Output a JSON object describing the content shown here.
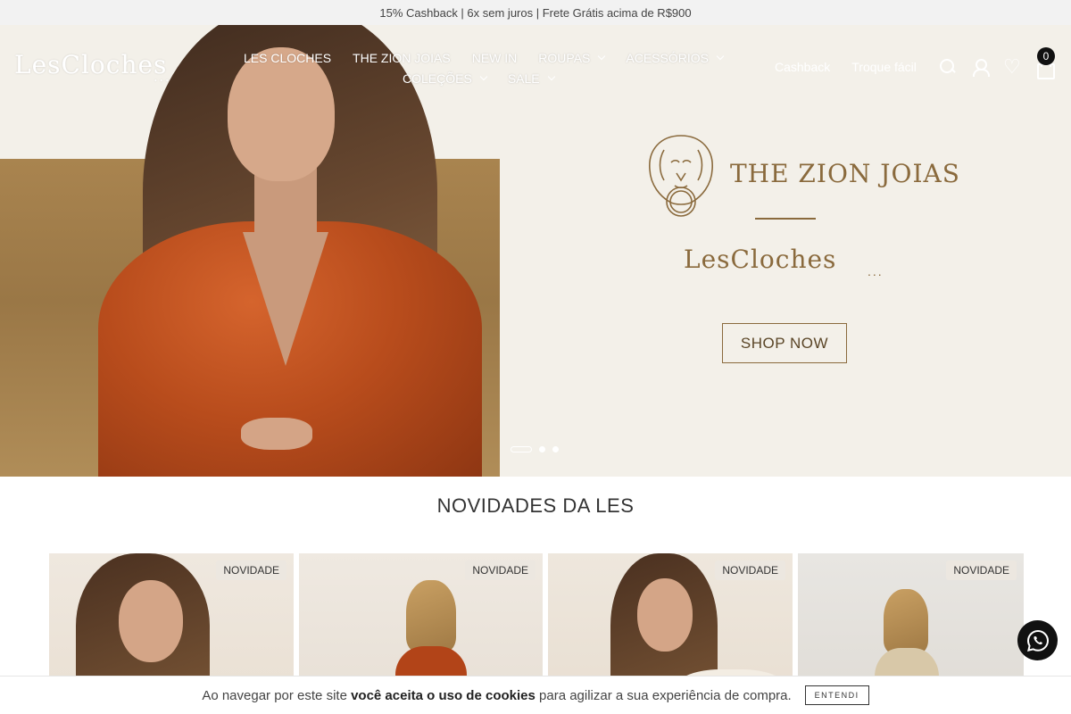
{
  "announcement": "15% Cashback | 6x sem juros | Frete Grátis acima de R$900",
  "header": {
    "logo": "LesCloches",
    "logo_dots": "...",
    "menu_row1": [
      {
        "label": "LES CLOCHES",
        "dropdown": false
      },
      {
        "label": "THE ZION JOIAS",
        "dropdown": false
      },
      {
        "label": "NEW IN",
        "dropdown": false
      },
      {
        "label": "ROUPAS",
        "dropdown": true
      },
      {
        "label": "ACESSÓRIOS",
        "dropdown": true
      }
    ],
    "menu_row2": [
      {
        "label": "COLEÇÕES",
        "dropdown": true
      },
      {
        "label": "SALE",
        "dropdown": true
      }
    ],
    "cashback": "Cashback",
    "troque": "Troque fácil",
    "cart_count": "0",
    "icons": [
      "search-icon",
      "user-icon",
      "heart-icon",
      "bag-icon"
    ]
  },
  "hero": {
    "brand_primary": "THE ZION JOIAS",
    "brand_secondary": "LesCloches",
    "brand_dots": "...",
    "cta": "SHOP NOW",
    "slides": 3,
    "active_slide": 1,
    "colors": {
      "gold": "#8a6a3d",
      "background": "#f3f0e9"
    }
  },
  "section": {
    "title": "NOVIDADES DA LES",
    "products": [
      {
        "badge": "NOVIDADE"
      },
      {
        "badge": "NOVIDADE"
      },
      {
        "badge": "NOVIDADE"
      },
      {
        "badge": "NOVIDADE"
      }
    ]
  },
  "cookie": {
    "text_before": "Ao navegar por este site ",
    "text_bold": "você aceita o uso de cookies",
    "text_after": " para agilizar a sua experiência de compra.",
    "button": "ENTENDI"
  }
}
